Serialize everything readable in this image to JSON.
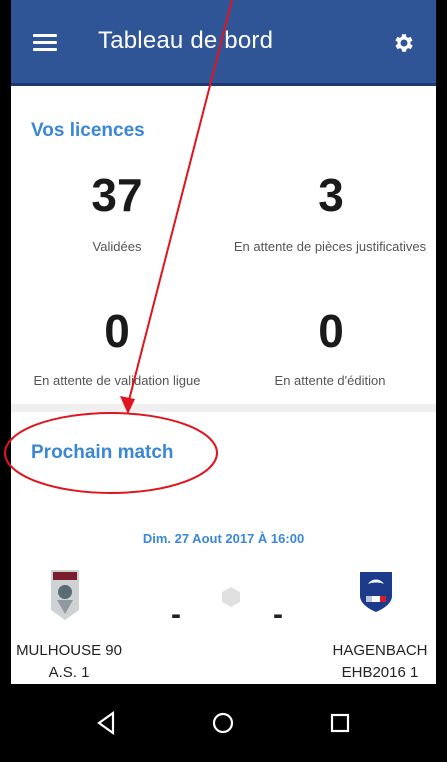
{
  "appbar": {
    "title": "Tableau de bord",
    "menu_icon": "hamburger-menu-icon",
    "settings_icon": "gear-icon"
  },
  "licences": {
    "title": "Vos licences",
    "stats": [
      {
        "value": "37",
        "label": "Validées"
      },
      {
        "value": "3",
        "label": "En attente de pièces justificatives"
      },
      {
        "value": "0",
        "label": "En attente de validation ligue"
      },
      {
        "value": "0",
        "label": "En attente d'édition"
      }
    ]
  },
  "match": {
    "title": "Prochain match",
    "date": "Dim. 27 Aout 2017 À 16:00",
    "home_team": {
      "line1": "MULHOUSE 90",
      "line2": "A.S. 1"
    },
    "away_team": {
      "line1": "HAGENBACH",
      "line2": "EHB2016 1"
    },
    "home_score": "-",
    "away_score": "-"
  },
  "navbar": {
    "back_icon": "back-triangle-icon",
    "home_icon": "home-circle-icon",
    "recents_icon": "recents-square-icon"
  },
  "colors": {
    "appbar": "#2f5597",
    "accent": "#3a87d6",
    "annotation": "#e0141e"
  }
}
